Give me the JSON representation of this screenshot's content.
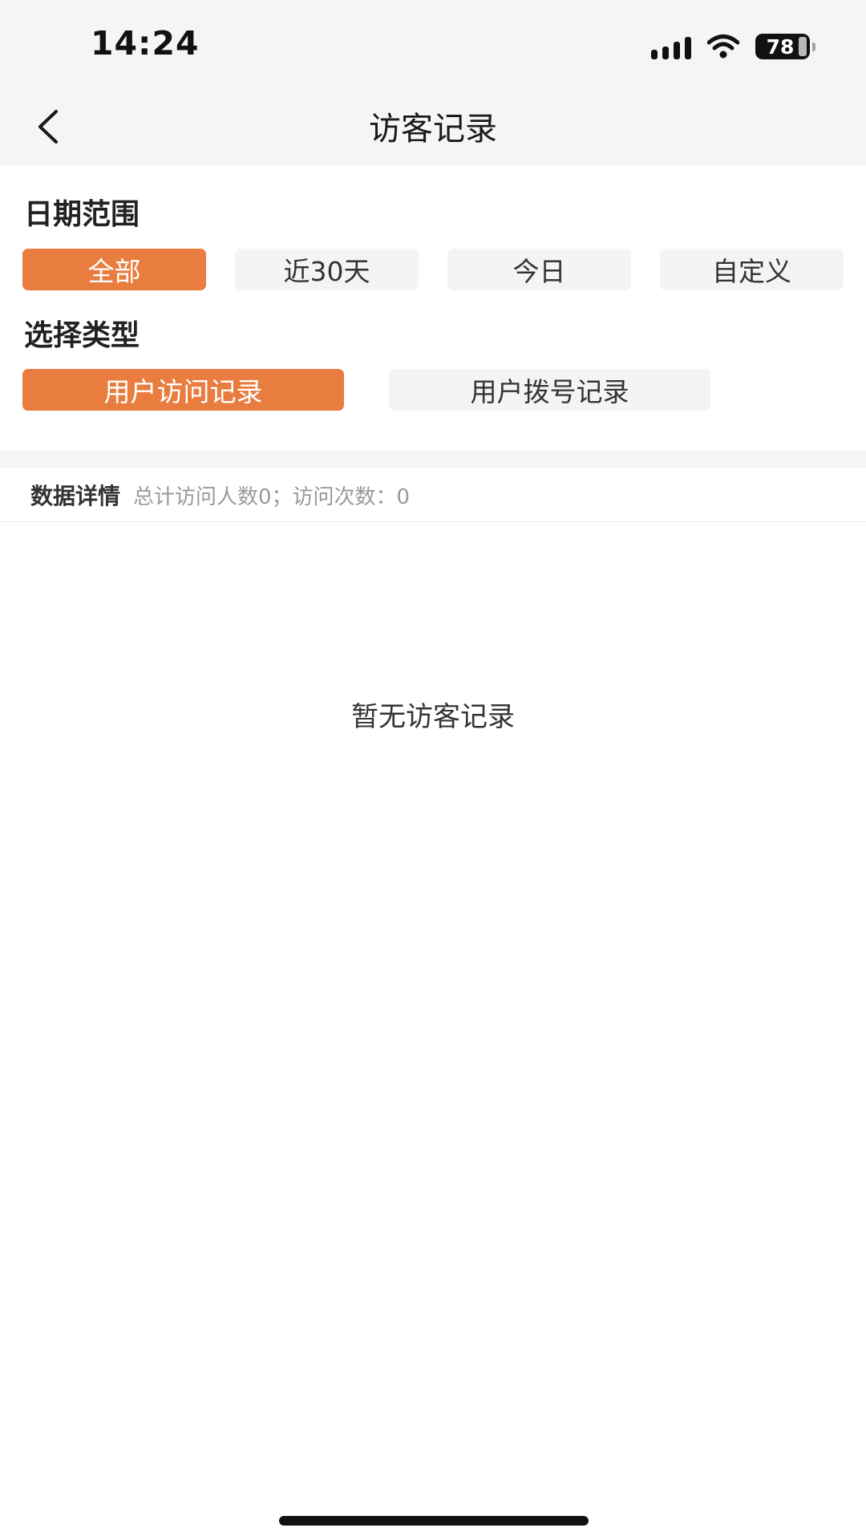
{
  "status_bar": {
    "time": "14:24",
    "battery_level": "78",
    "signal_icon": "signal-icon",
    "wifi_icon": "wifi-icon",
    "battery_icon": "battery-icon"
  },
  "nav": {
    "title": "访客记录",
    "back_icon": "chevron-left-icon"
  },
  "date_range": {
    "label": "日期范围",
    "options": [
      "全部",
      "近30天",
      "今日",
      "自定义"
    ],
    "selected": "全部"
  },
  "record_type": {
    "label": "选择类型",
    "options": [
      "用户访问记录",
      "用户拨号记录"
    ],
    "selected": "用户访问记录"
  },
  "details": {
    "title": "数据详情",
    "summary": "总计访问人数0；访问次数：0"
  },
  "empty_state": {
    "message": "暂无访客记录"
  },
  "colors": {
    "accent": "#e97d3f",
    "chip_inactive": "#f4f4f4",
    "header_bg": "#f5f5f5"
  }
}
